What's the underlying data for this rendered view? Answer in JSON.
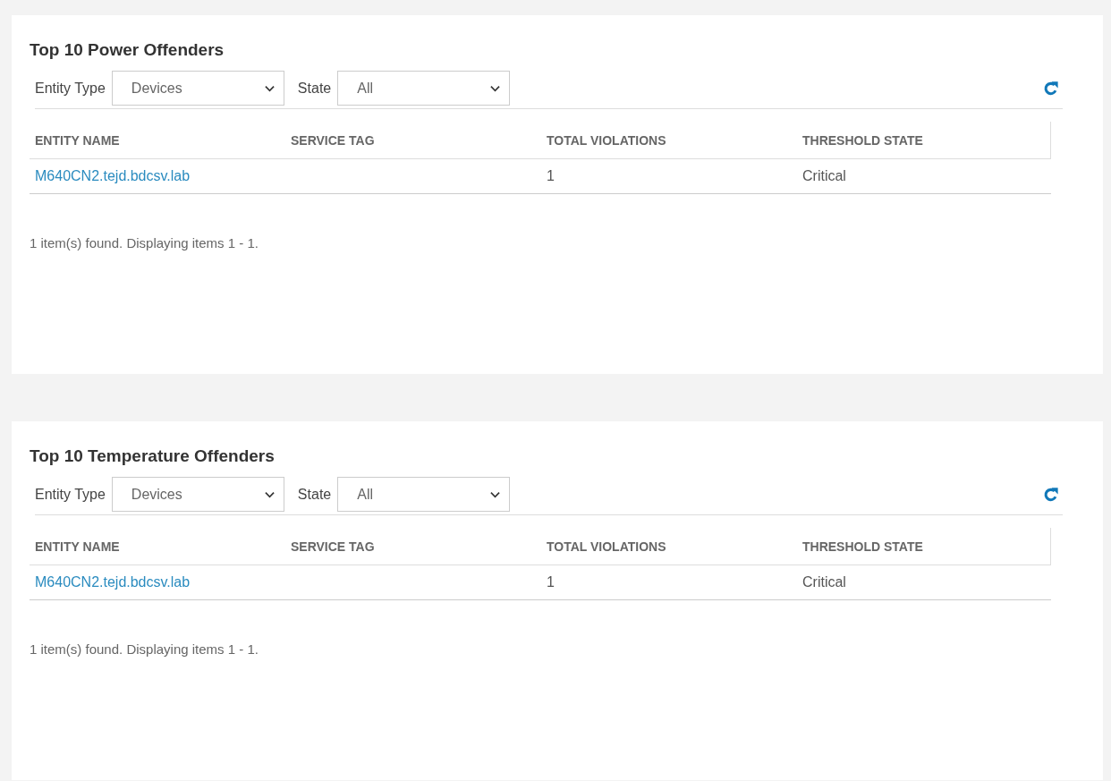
{
  "panels": [
    {
      "title": "Top 10 Power Offenders",
      "filters": [
        {
          "label": "Entity Type",
          "value": "Devices"
        },
        {
          "label": "State",
          "value": "All"
        }
      ],
      "columns": [
        "ENTITY NAME",
        "SERVICE TAG",
        "TOTAL VIOLATIONS",
        "THRESHOLD STATE"
      ],
      "rows": [
        {
          "entity_name": "M640CN2.tejd.bdcsv.lab",
          "total_violations": "1",
          "threshold_state": "Critical"
        }
      ],
      "summary": "1 item(s) found. Displaying items 1 - 1."
    },
    {
      "title": "Top 10 Temperature Offenders",
      "filters": [
        {
          "label": "Entity Type",
          "value": "Devices"
        },
        {
          "label": "State",
          "value": "All"
        }
      ],
      "columns": [
        "ENTITY NAME",
        "SERVICE TAG",
        "TOTAL VIOLATIONS",
        "THRESHOLD STATE"
      ],
      "rows": [
        {
          "entity_name": "M640CN2.tejd.bdcsv.lab",
          "total_violations": "1",
          "threshold_state": "Critical"
        }
      ],
      "summary": "1 item(s) found. Displaying items 1 - 1."
    }
  ]
}
